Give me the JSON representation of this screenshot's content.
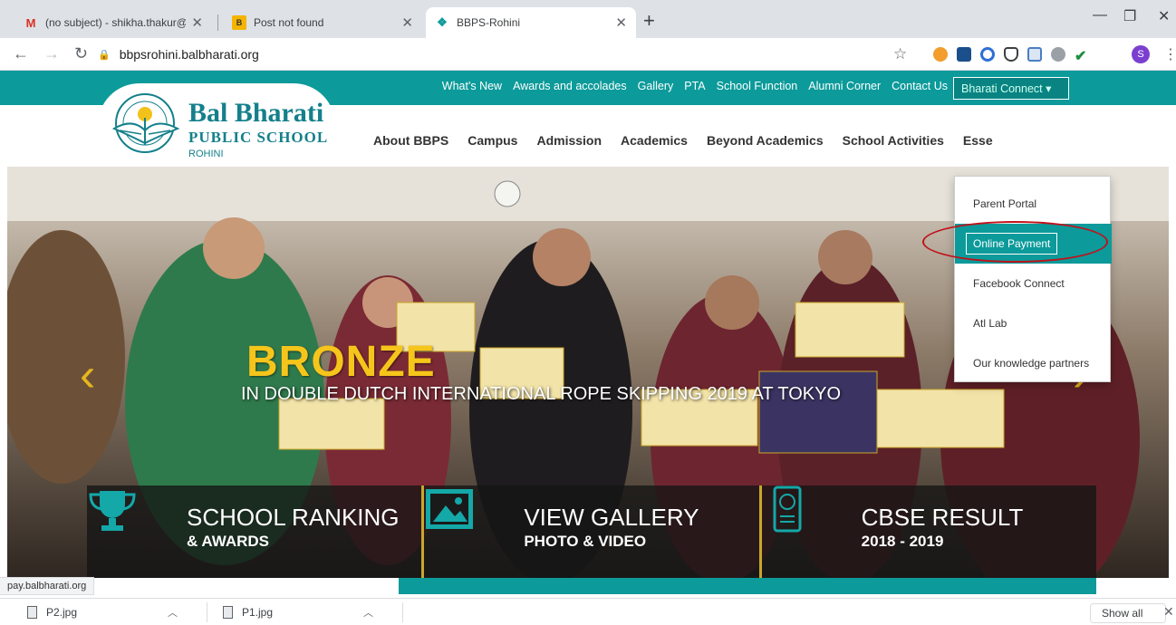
{
  "browser": {
    "tabs": [
      {
        "title": "(no subject) - shikha.thakur@rh.b",
        "icon": "gmail-icon",
        "active": false
      },
      {
        "title": "Post not found",
        "icon": "blogger-icon",
        "active": false
      },
      {
        "title": "BBPS-Rohini",
        "icon": "site-icon",
        "active": true
      }
    ],
    "address": "bbpsrohini.balbharati.org",
    "profile_initial": "S",
    "status_url": "pay.balbharati.org"
  },
  "site": {
    "top_nav": [
      "What's New",
      "Awards and accolades",
      "Gallery",
      "PTA",
      "School Function",
      "Alumni Corner",
      "Contact Us"
    ],
    "connect_label": "Bharati Connect ▾",
    "logo": {
      "name": "Bal Bharati",
      "sub": "PUBLIC SCHOOL",
      "city": "ROHINI"
    },
    "main_nav": [
      "About BBPS",
      "Campus",
      "Admission",
      "Academics",
      "Beyond Academics",
      "School Activities",
      "Esse"
    ],
    "dropdown": [
      {
        "label": "Parent Portal",
        "active": false
      },
      {
        "label": "Online Payment",
        "active": true
      },
      {
        "label": "Facebook Connect",
        "active": false
      },
      {
        "label": "Atl Lab",
        "active": false
      },
      {
        "label": "Our knowledge partners",
        "active": false
      }
    ],
    "hero": {
      "title": "BRONZE",
      "subtitle": "IN DOUBLE DUTCH INTERNATIONAL ROPE SKIPPING 2019 AT TOKYO"
    },
    "stats": [
      {
        "title": "SCHOOL RANKING",
        "sub": "& AWARDS",
        "icon": "trophy-icon"
      },
      {
        "title": "VIEW GALLERY",
        "sub": "PHOTO & VIDEO",
        "icon": "picture-icon"
      },
      {
        "title": "CBSE RESULT",
        "sub": "2018 - 2019",
        "icon": "certificate-icon"
      }
    ]
  },
  "downloads": {
    "items": [
      "P2.jpg",
      "P1.jpg"
    ],
    "show_all": "Show all"
  },
  "colors": {
    "teal": "#0c9a9a",
    "gold": "#f6c51b",
    "highlight_oval": "#c0121a"
  }
}
